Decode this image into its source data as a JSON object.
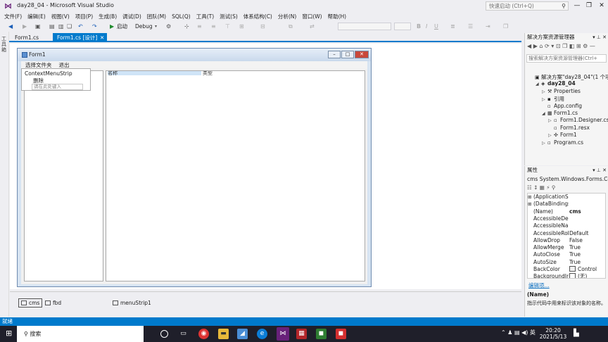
{
  "window": {
    "title": "day28_04 - Microsoft Visual Studio",
    "quick_launch_placeholder": "快速启动 (Ctrl+Q)",
    "min": "—",
    "max": "❐",
    "close": "✕"
  },
  "menubar": [
    "文件(F)",
    "编辑(E)",
    "视图(V)",
    "项目(P)",
    "生成(B)",
    "调试(D)",
    "团队(M)",
    "SQL(Q)",
    "工具(T)",
    "测试(S)",
    "体系结构(C)",
    "分析(N)",
    "窗口(W)",
    "帮助(H)"
  ],
  "toolbar": {
    "start_label": "启动",
    "config": "Debug"
  },
  "leftstrip": {
    "label": "工具箱"
  },
  "doc_tabs": [
    {
      "label": "Form1.cs"
    },
    {
      "label": "Form1.cs [设计]",
      "close": "✕"
    }
  ],
  "form": {
    "title": "Form1",
    "menu": [
      "选择文件夹",
      "退出"
    ],
    "listview_columns": [
      "名称",
      "类型"
    ]
  },
  "context_menu": {
    "header": "ContextMenuStrip",
    "items": [
      "删除"
    ],
    "placeholder": "请在此处键入"
  },
  "component_tray": [
    "cms",
    "fbd",
    "menuStrip1"
  ],
  "solution_explorer": {
    "title": "解决方案资源管理器",
    "search_placeholder": "搜索解决方案资源管理器(Ctrl+",
    "tree": [
      {
        "label": "解决方案\"day28_04\"(1 个项目)",
        "level": 0,
        "icon": "solution-icon",
        "expander": ""
      },
      {
        "label": "day28_04",
        "level": 1,
        "icon": "csharp-project-icon",
        "expander": "◢",
        "bold": true
      },
      {
        "label": "Properties",
        "level": 2,
        "icon": "wrench-icon",
        "expander": "▷"
      },
      {
        "label": "引用",
        "level": 2,
        "icon": "references-icon",
        "expander": "▷"
      },
      {
        "label": "App.config",
        "level": 2,
        "icon": "config-file-icon",
        "expander": ""
      },
      {
        "label": "Form1.cs",
        "level": 2,
        "icon": "form-icon",
        "expander": "◢"
      },
      {
        "label": "Form1.Designer.cs",
        "level": 3,
        "icon": "csharp-file-icon",
        "expander": "▷"
      },
      {
        "label": "Form1.resx",
        "level": 3,
        "icon": "resx-file-icon",
        "expander": ""
      },
      {
        "label": "Form1",
        "level": 3,
        "icon": "class-icon",
        "expander": "▷"
      },
      {
        "label": "Program.cs",
        "level": 2,
        "icon": "csharp-file-icon",
        "expander": "▷"
      }
    ]
  },
  "properties": {
    "title": "属性",
    "object": "cms System.Windows.Forms.Co",
    "rows": [
      {
        "cat": "⊞",
        "name": "(ApplicationSe",
        "value": ""
      },
      {
        "cat": "⊞",
        "name": "(DataBindings)",
        "value": ""
      },
      {
        "cat": "",
        "name": "(Name)",
        "value": "cms",
        "bold": true
      },
      {
        "cat": "",
        "name": "AccessibleDesc",
        "value": ""
      },
      {
        "cat": "",
        "name": "AccessibleNam",
        "value": ""
      },
      {
        "cat": "",
        "name": "AccessibleRole",
        "value": "Default"
      },
      {
        "cat": "",
        "name": "AllowDrop",
        "value": "False"
      },
      {
        "cat": "",
        "name": "AllowMerge",
        "value": "True"
      },
      {
        "cat": "",
        "name": "AutoClose",
        "value": "True"
      },
      {
        "cat": "",
        "name": "AutoSize",
        "value": "True"
      },
      {
        "cat": "",
        "name": "BackColor",
        "value": "Control",
        "swatch": "#f0f0f0"
      },
      {
        "cat": "",
        "name": "BackgroundIm",
        "value": "(无)",
        "swatch": "#ffffff"
      }
    ],
    "link": "编辑项...",
    "desc_name": "(Name)",
    "desc_text": "指示代码中用来标识该对象的名称。"
  },
  "status": {
    "text": "就绪"
  },
  "taskbar": {
    "search": "搜索",
    "tray_text": "英",
    "time": "20:20",
    "date": "2021/5/13"
  },
  "colors": {
    "accent": "#007acc",
    "vs_purple": "#68217a",
    "form_close": "#c9483a",
    "taskbar": "#1f1f2a"
  }
}
